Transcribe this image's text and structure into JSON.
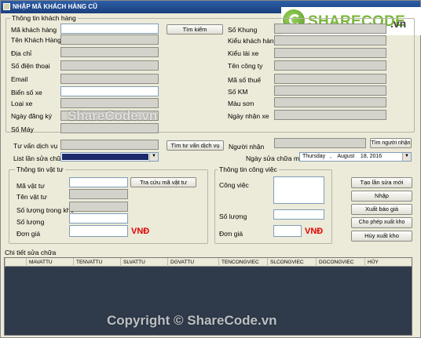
{
  "window": {
    "title": "NHẬP MÃ KHÁCH HÀNG CŨ"
  },
  "logo": {
    "brand": "SHARECODE",
    "tld": ".vn"
  },
  "customer": {
    "legend": "Thông tin khách hàng",
    "search_button": "Tìm kiếm",
    "left_labels": [
      "Mã khách hàng",
      "Tên Khách Hàng",
      "Địa chỉ",
      "Số điện thoại",
      "Email",
      "Biển số xe",
      "Loại xe",
      "Ngày đăng ký",
      "Số Máy"
    ],
    "right_labels": [
      "Số Khung",
      "Kiểu khách hàng",
      "Kiểu lái xe",
      "Tên công ty",
      "Mã số thuế",
      "Số KM",
      "Màu sơn",
      "Ngày nhận xe"
    ]
  },
  "service": {
    "advisor_label": "Tư vấn dịch vụ",
    "find_advisor_button": "Tìm tư vấn dịch vụ",
    "receiver_label": "Người nhận",
    "find_receiver_button": "Tìm người nhận",
    "list_label": "List lần sửa chữa",
    "date_label": "Ngày sửa chữa mới",
    "date_value": "Thursday   ,    August    18, 2016"
  },
  "material": {
    "legend": "Thông tin vật tư",
    "labels": [
      "Mã vật tư",
      "Tên vật tư",
      "Số lượng trong kho",
      "Số lượng",
      "Đơn giá"
    ],
    "lookup_button": "Tra cứu mã vật tư",
    "currency": "VNĐ"
  },
  "job": {
    "legend": "Thông tin công việc",
    "labels": [
      "Công việc",
      "Số lượng",
      "Đơn giá"
    ],
    "currency": "VNĐ"
  },
  "actions": [
    "Tạo lần sửa mới",
    "Nhập",
    "Xuất báo giá",
    "Cho phép xuất kho",
    "Hủy xuất kho"
  ],
  "details": {
    "label": "Chi tiết sửa chữa",
    "columns": [
      "MAVATTU",
      "TENVATTU",
      "SLVATTU",
      "DGVATTU",
      "TENCONGVIEC",
      "SLCONGVIEC",
      "DGCONGVIEC",
      "HỦY"
    ]
  },
  "watermarks": {
    "center": "ShareCode.vn",
    "bottom": "Copyright © ShareCode.vn"
  },
  "colors": {
    "titlebar": "#1b3f7e",
    "currency": "#e00000",
    "brand": "#7ab83a",
    "grid_bg": "#2f3b4b"
  }
}
